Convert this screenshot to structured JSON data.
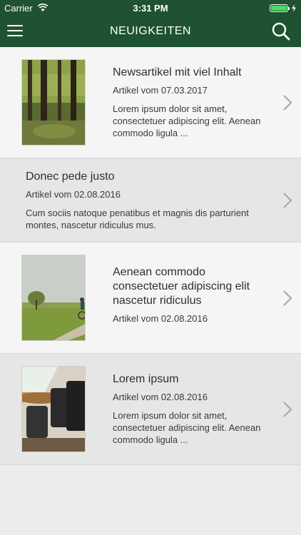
{
  "status_bar": {
    "carrier": "Carrier",
    "time": "3:31 PM"
  },
  "navbar": {
    "title": "NEUIGKEITEN",
    "menu_icon": "hamburger-menu-icon",
    "search_icon": "search-icon"
  },
  "articles": [
    {
      "title": "Newsartikel mit viel Inhalt",
      "date": "Artikel vom 07.03.2017",
      "excerpt": "Lorem ipsum dolor sit amet, consectetuer adipiscing elit. Aenean commodo ligula ...",
      "image": "forest-photo"
    },
    {
      "title": "Donec pede justo",
      "date": "Artikel vom 02.08.2016",
      "excerpt": "Cum sociis natoque penatibus et magnis dis parturient montes, nascetur ridiculus mus."
    },
    {
      "title": "Aenean commodo consectetuer adipiscing elit nascetur ridiculus",
      "date": "Artikel vom 02.08.2016",
      "excerpt": "",
      "image": "cyclist-field-photo"
    },
    {
      "title": "Lorem ipsum",
      "date": "Artikel vom 02.08.2016",
      "excerpt": "Lorem ipsum dolor sit amet, consectetuer adipiscing elit. Aenean commodo ligula ...",
      "image": "office-chairs-photo"
    }
  ],
  "colors": {
    "brand": "#1e5232",
    "battery": "#4cd964",
    "chevron": "#a9a9a9"
  }
}
